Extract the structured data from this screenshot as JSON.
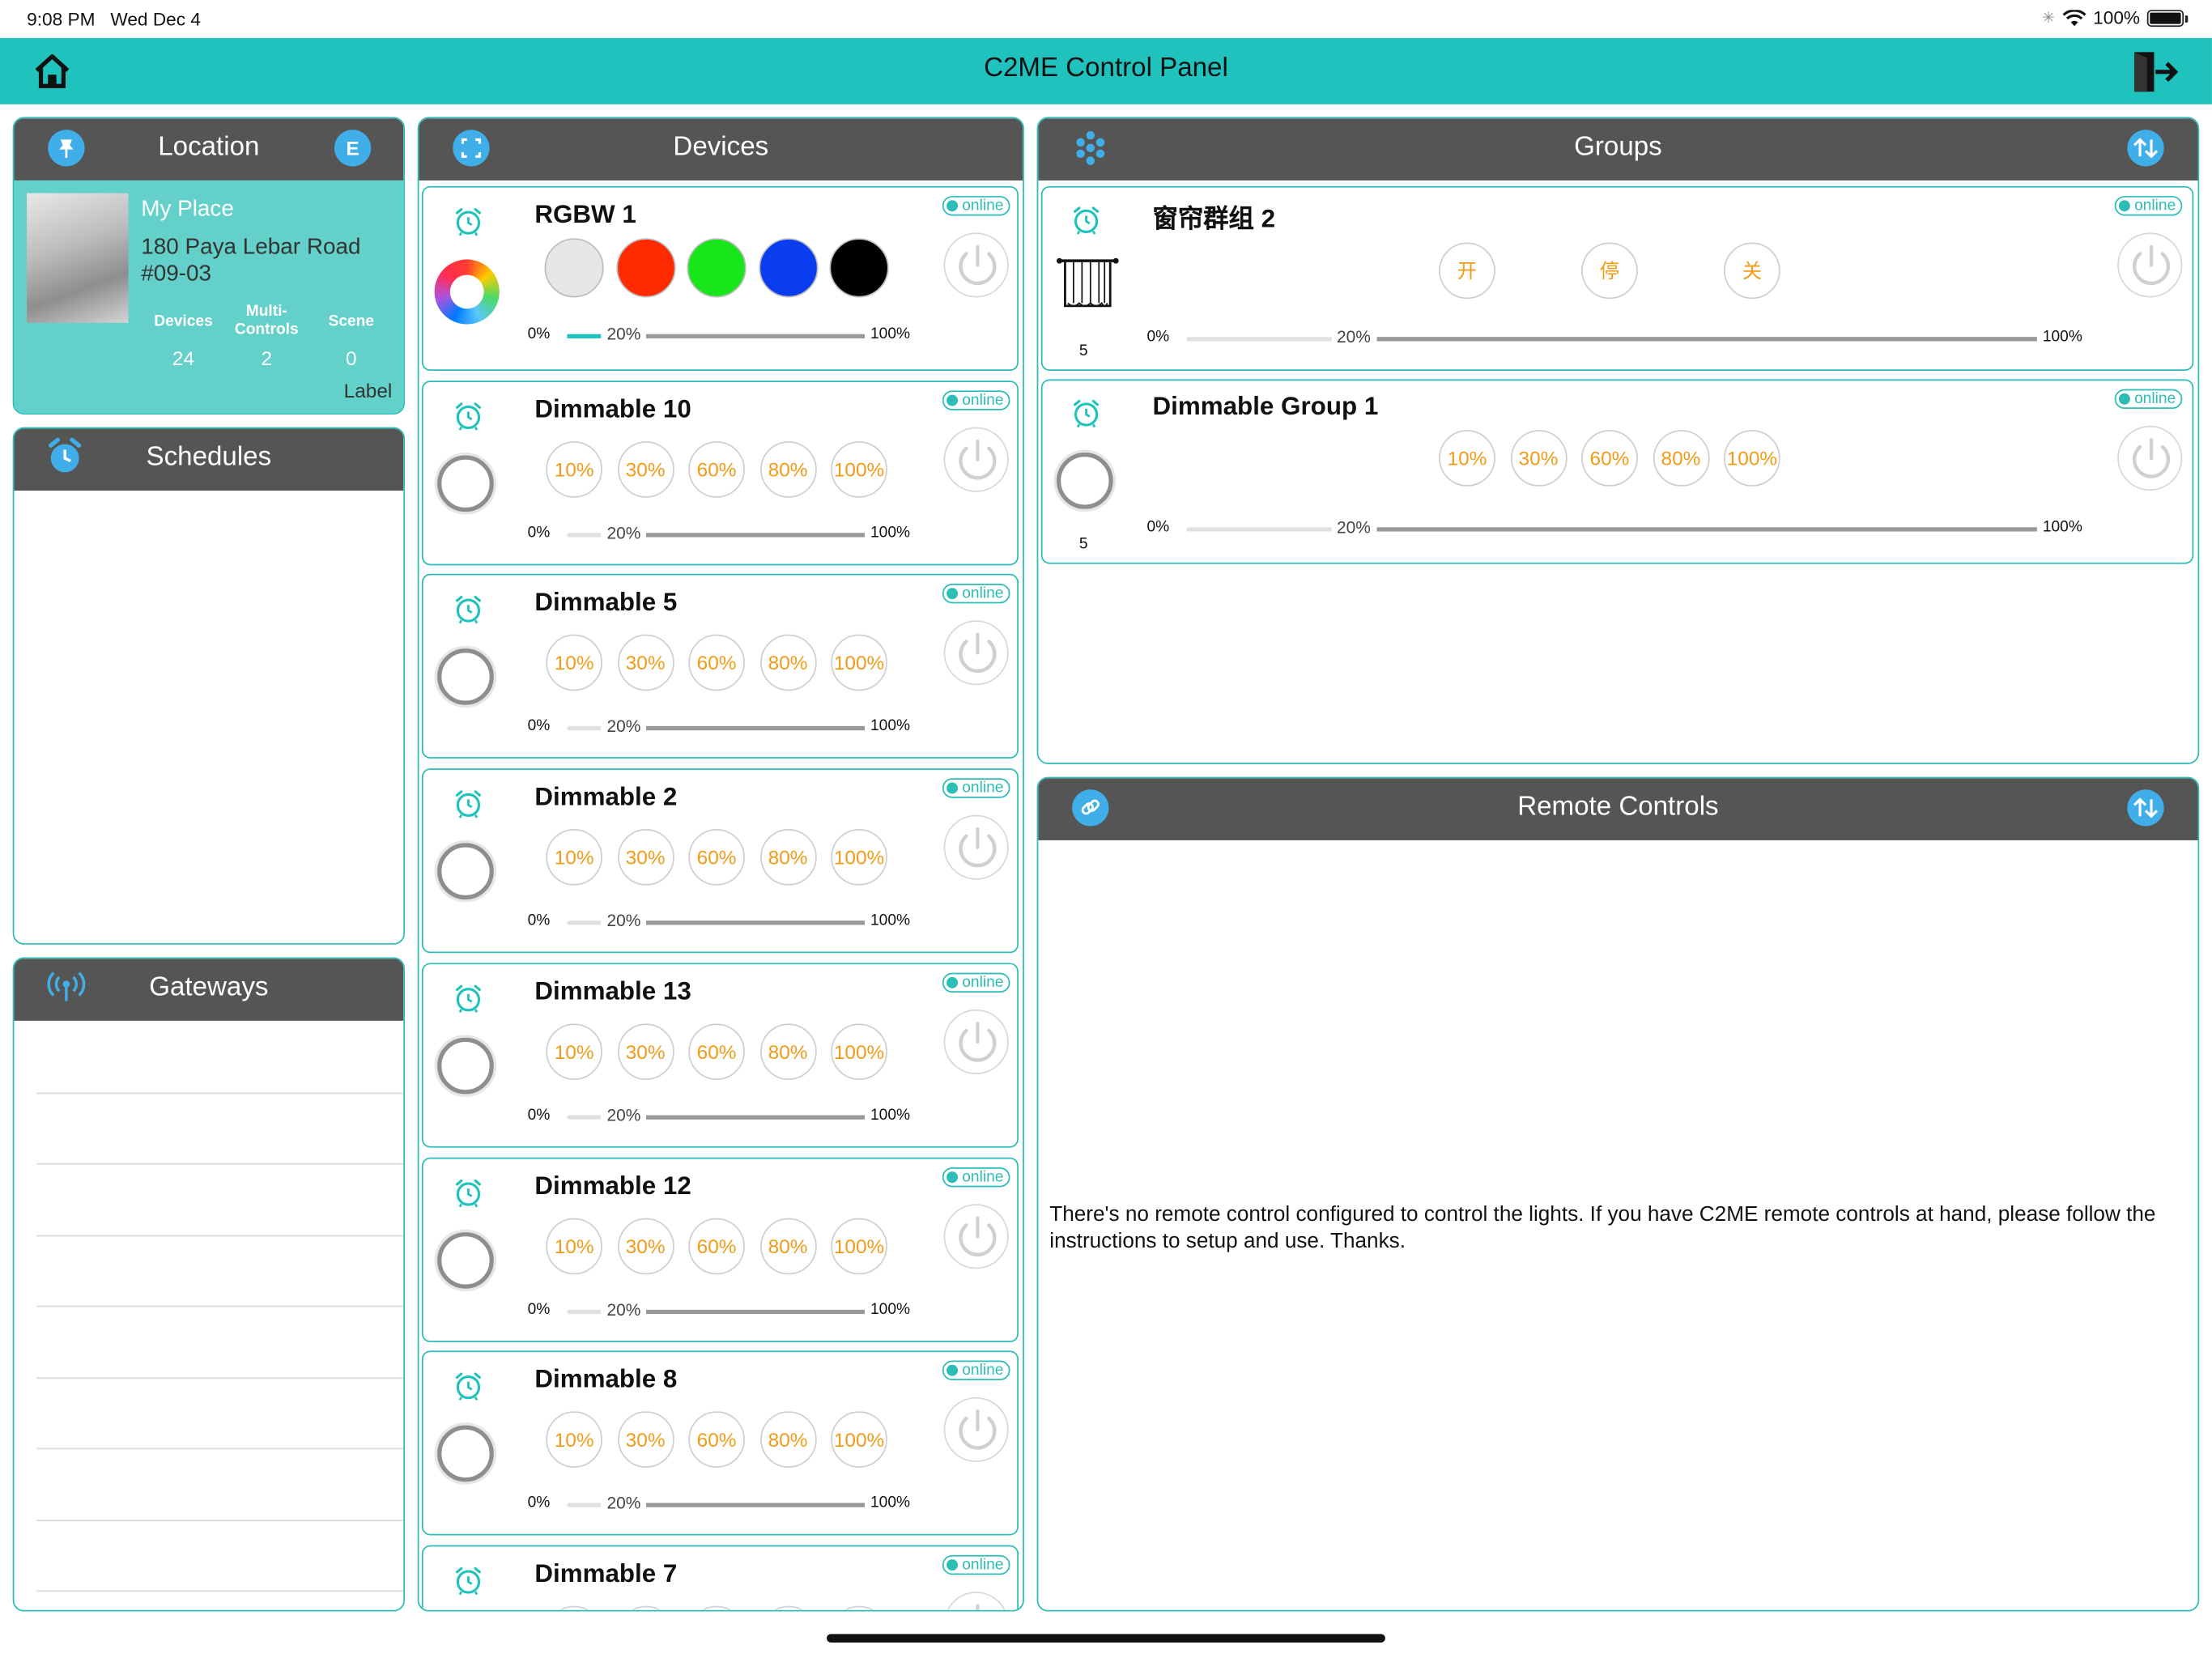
{
  "status_bar": {
    "time": "9:08 PM",
    "date": "Wed Dec 4",
    "battery": "100%"
  },
  "nav": {
    "title": "C2ME Control Panel"
  },
  "location": {
    "header": "Location",
    "edit_badge": "E",
    "place_name": "My Place",
    "address": "180 Paya Lebar Road #09-03",
    "stats": [
      {
        "label": "Devices",
        "value": "24"
      },
      {
        "label": "Multi-Controls",
        "value": "2"
      },
      {
        "label": "Scene",
        "value": "0"
      }
    ],
    "label_text": "Label"
  },
  "schedules": {
    "header": "Schedules"
  },
  "gateways": {
    "header": "Gateways"
  },
  "devices": {
    "header": "Devices",
    "status_online": "online",
    "slider_min": "0%",
    "slider_max": "100%",
    "levels": [
      "10%",
      "30%",
      "60%",
      "80%",
      "100%"
    ],
    "items": [
      {
        "name": "RGBW 1",
        "type": "rgbw",
        "slider": "20%",
        "slider_value": 0.2,
        "colors": [
          "#e6e6e6",
          "#ff2a00",
          "#19e61a",
          "#0a3cf0",
          "#000000"
        ]
      },
      {
        "name": "Dimmable 10",
        "type": "dim",
        "slider": "20%",
        "slider_value": 0.2
      },
      {
        "name": "Dimmable 5",
        "type": "dim",
        "slider": "20%",
        "slider_value": 0.2
      },
      {
        "name": "Dimmable 2",
        "type": "dim",
        "slider": "20%",
        "slider_value": 0.2
      },
      {
        "name": "Dimmable 13",
        "type": "dim",
        "slider": "20%",
        "slider_value": 0.2
      },
      {
        "name": "Dimmable 12",
        "type": "dim",
        "slider": "20%",
        "slider_value": 0.2
      },
      {
        "name": "Dimmable 8",
        "type": "dim",
        "slider": "20%",
        "slider_value": 0.2
      },
      {
        "name": "Dimmable 7",
        "type": "dim",
        "slider": "20%",
        "slider_value": 0.2
      }
    ]
  },
  "groups": {
    "header": "Groups",
    "status_online": "online",
    "slider_min": "0%",
    "slider_max": "100%",
    "items": [
      {
        "name": "窗帘群组 2",
        "count": "5",
        "buttons": [
          "开",
          "停",
          "关"
        ],
        "slider": "20%",
        "slider_value": 0.2
      },
      {
        "name": "Dimmable Group 1",
        "count": "5",
        "buttons": [
          "10%",
          "30%",
          "60%",
          "80%",
          "100%"
        ],
        "slider": "20%",
        "slider_value": 0.2
      }
    ]
  },
  "remote_controls": {
    "header": "Remote Controls",
    "message": "There's no remote control configured to control the lights. If you have C2ME remote controls at hand, please follow the instructions to setup and use. Thanks."
  },
  "colors": {
    "accent": "#1fc2bd",
    "header_bg": "#555555",
    "level_text": "#f29b16",
    "icon_blue": "#40aee8"
  }
}
